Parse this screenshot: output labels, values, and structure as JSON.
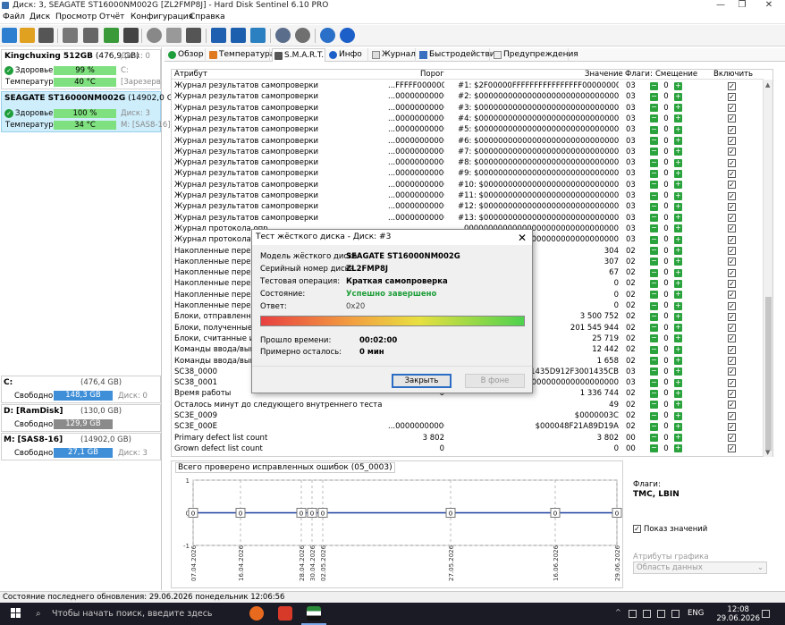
{
  "window": {
    "title": "Диск: 3, SEAGATE ST16000NM002G [ZL2FMP8J]  -  Hard Disk Sentinel 6.10 PRO",
    "minimize": "—",
    "maximize": "❐",
    "close": "✕"
  },
  "menu": [
    "Файл",
    "Диск",
    "Просмотр",
    "Отчёт",
    "Конфигурация",
    "Справка"
  ],
  "disks": [
    {
      "name": "Kingchuxing 512GB",
      "size": "(476,9 GB)",
      "disk": "Диск: 0",
      "health_label": "Здоровье:",
      "health": "99 %",
      "health_extra": "C:",
      "temp_label": "Температура:",
      "temp": "40 °C",
      "temp_extra": "[Зарезерв"
    },
    {
      "name": "SEAGATE ST16000NM002G",
      "size": "(14902,0 GB)",
      "disk": "Диск: 3",
      "health_label": "Здоровье:",
      "health": "100 %",
      "health_extra": "",
      "temp_label": "Температура:",
      "temp": "34 °C",
      "temp_extra": "M: [SAS8-16]"
    }
  ],
  "volumes": [
    {
      "letter": "C:",
      "name": "",
      "size": "(476,4 GB)",
      "free_label": "Свободно",
      "free": "148,3 GB",
      "disk": "Диск: 0",
      "color": "#3f8fd8"
    },
    {
      "letter": "D:",
      "name": "[RamDisk]",
      "size": "(130,0 GB)",
      "free_label": "Свободно",
      "free": "129,9 GB",
      "disk": "",
      "color": "#8a8a8a"
    },
    {
      "letter": "M:",
      "name": "[SAS8-16]",
      "size": "(14902,0 GB)",
      "free_label": "Свободно",
      "free": "27,1 GB",
      "disk": "Диск: 3",
      "color": "#3f8fd8"
    }
  ],
  "tabs": [
    "Обзор",
    "Температура",
    "S.M.A.R.T.",
    "Инфо",
    "Журнал",
    "Быстродействие",
    "Предупреждения"
  ],
  "table": {
    "headers": {
      "attr": "Атрибут",
      "threshold": "Порог",
      "value": "Значение",
      "flags": "Флаги:",
      "offset": "Смещение",
      "enable": "Включить"
    },
    "rows": [
      {
        "attr": "Журнал результатов самопроверки",
        "thr": "...FFFFF00000000",
        "val": "#1: $2F00000FFFFFFFFFFFFFFFF00000000",
        "flag": "03"
      },
      {
        "attr": "Журнал результатов самопроверки",
        "thr": "...000000000000",
        "val": "#2: $00000000000000000000000000000000",
        "flag": "03"
      },
      {
        "attr": "Журнал результатов самопроверки",
        "thr": "...000000000000",
        "val": "#3: $00000000000000000000000000000000",
        "flag": "03"
      },
      {
        "attr": "Журнал результатов самопроверки",
        "thr": "...000000000000",
        "val": "#4: $00000000000000000000000000000000",
        "flag": "03"
      },
      {
        "attr": "Журнал результатов самопроверки",
        "thr": "...000000000000",
        "val": "#5: $00000000000000000000000000000000",
        "flag": "03"
      },
      {
        "attr": "Журнал результатов самопроверки",
        "thr": "...000000000000",
        "val": "#6: $00000000000000000000000000000000",
        "flag": "03"
      },
      {
        "attr": "Журнал результатов самопроверки",
        "thr": "...000000000000",
        "val": "#7: $00000000000000000000000000000000",
        "flag": "03"
      },
      {
        "attr": "Журнал результатов самопроверки",
        "thr": "...000000000000",
        "val": "#8: $00000000000000000000000000000000",
        "flag": "03"
      },
      {
        "attr": "Журнал результатов самопроверки",
        "thr": "...000000000000",
        "val": "#9: $00000000000000000000000000000000",
        "flag": "03"
      },
      {
        "attr": "Журнал результатов самопроверки",
        "thr": "...000000000000",
        "val": "#10: $00000000000000000000000000000000",
        "flag": "03"
      },
      {
        "attr": "Журнал результатов самопроверки",
        "thr": "...000000000000",
        "val": "#11: $00000000000000000000000000000000",
        "flag": "03"
      },
      {
        "attr": "Журнал результатов самопроверки",
        "thr": "...000000000000",
        "val": "#12: $00000000000000000000000000000000",
        "flag": "03"
      },
      {
        "attr": "Журнал результатов самопроверки",
        "thr": "...000000000000",
        "val": "#13: $00000000000000000000000000000000",
        "flag": "03"
      },
      {
        "attr": "Журнал протокола опр",
        "thr": "",
        "val": "00000000000000000000000000000000",
        "flag": "03"
      },
      {
        "attr": "Журнал протокола опр",
        "thr": "",
        "val": "00000000000400000000000000000000",
        "flag": "03"
      },
      {
        "attr": "Накопленные переход",
        "thr": "",
        "val": "304",
        "flag": "02"
      },
      {
        "attr": "Накопленные переход",
        "thr": "",
        "val": "307",
        "flag": "02"
      },
      {
        "attr": "Накопленные переход",
        "thr": "",
        "val": "67",
        "flag": "02"
      },
      {
        "attr": "Накопленные переход",
        "thr": "",
        "val": "0",
        "flag": "02"
      },
      {
        "attr": "Накопленные переход",
        "thr": "",
        "val": "0",
        "flag": "02"
      },
      {
        "attr": "Накопленные переход",
        "thr": "",
        "val": "0",
        "flag": "02"
      },
      {
        "attr": "Блоки, отправленные и",
        "thr": "",
        "val": "3 500 752",
        "flag": "02"
      },
      {
        "attr": "Блоки, полученные от и",
        "thr": "",
        "val": "201 545 944",
        "flag": "02"
      },
      {
        "attr": "Блоки, считанные из кэ",
        "thr": "",
        "val": "25 719",
        "flag": "02"
      },
      {
        "attr": "Команды ввода/вывода",
        "thr": "",
        "val": "12 442",
        "flag": "02"
      },
      {
        "attr": "Команды ввода/вывода",
        "thr": "",
        "val": "1 658",
        "flag": "02"
      },
      {
        "attr": "SC38_0000",
        "thr": "",
        "val": "30E001435D912F3001435CB",
        "flag": "03"
      },
      {
        "attr": "SC38_0001",
        "thr": "",
        "val": "00000000000000000000000",
        "flag": "03"
      },
      {
        "attr": "Время работы",
        "thr": "0",
        "val": "1 336 744",
        "flag": "02"
      },
      {
        "attr": "Осталось минут до следующего внутреннего теста",
        "thr": "",
        "val": "49",
        "flag": "02"
      },
      {
        "attr": "SC3E_0009",
        "thr": "",
        "val": "$0000003C",
        "flag": "02"
      },
      {
        "attr": "SC3E_000E",
        "thr": "...000000000000",
        "val": "$000048F21A89D19A",
        "flag": "02"
      },
      {
        "attr": "Primary defect list count",
        "thr": "3 802",
        "val": "3 802",
        "flag": "00"
      },
      {
        "attr": "Grown defect list count",
        "thr": "0",
        "val": "0",
        "flag": "00"
      }
    ]
  },
  "chart_data": {
    "type": "line",
    "title": "Всего проверено исправленных ошибок (05_0003)",
    "x": [
      "07.04.2026",
      "16.04.2026",
      "28.04.2026",
      "30.04.2026",
      "02.05.2026",
      "27.05.2026",
      "16.06.2026",
      "29.06.2026"
    ],
    "series": [
      {
        "values": [
          0,
          0,
          0,
          0,
          0,
          0,
          0,
          0
        ]
      }
    ],
    "ylim": [
      -1,
      1
    ],
    "y_ticks": [
      "1",
      "0",
      "-1"
    ],
    "grid": true,
    "color": "#1a3fa0"
  },
  "chart_side": {
    "flags_label": "Флаги:",
    "flags_value": "TMC, LBIN",
    "show_values_label": "Показ значений",
    "attrs_label": "Атрибуты графика",
    "attrs_select": "Область данных"
  },
  "dialog": {
    "title": "Тест жёсткого диска - Диск: #3",
    "close": "✕",
    "fields": [
      {
        "label": "Модель жёсткого диска",
        "value": "SEAGATE ST16000NM002G",
        "bold": true,
        "color": "#000"
      },
      {
        "label": "Серийный номер диска",
        "value": "ZL2FMP8J",
        "bold": true,
        "color": "#000"
      },
      {
        "label": "Тестовая операция:",
        "value": "Краткая самопроверка",
        "bold": true,
        "color": "#000"
      },
      {
        "label": "Состояние:",
        "value": "Успешно завершено",
        "bold": true,
        "color": "#1e9e3a"
      },
      {
        "label": "Ответ:",
        "value": "0x20",
        "bold": false,
        "color": "#444"
      }
    ],
    "progress": 1.0,
    "elapsed_label": "Прошло времени:",
    "elapsed": "00:02:00",
    "remaining_label": "Примерно осталось:",
    "remaining": "0 мин",
    "btn_close": "Закрыть",
    "btn_background": "В фоне"
  },
  "status": "Состояние последнего обновления: 29.06.2026 понедельник 12:06:56",
  "taskbar": {
    "search": "Чтобы начать поиск, введите здесь запрос",
    "lang": "ENG",
    "time": "12:08",
    "date": "29.06.2026"
  }
}
